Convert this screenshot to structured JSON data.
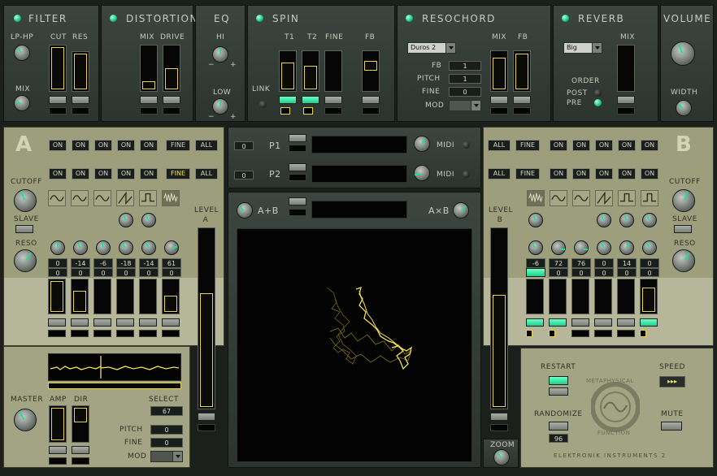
{
  "sections": {
    "filter": "FILTER",
    "distortion": "DISTORTION",
    "eq": "EQ",
    "spin": "SPIN",
    "resochord": "RESOCHORD",
    "reverb": "REVERB",
    "volume": "VOLUME"
  },
  "filter": {
    "lphp": "LP-HP",
    "cut": "CUT",
    "res": "RES",
    "mix": "MIX"
  },
  "distortion": {
    "mix": "MIX",
    "drive": "DRIVE"
  },
  "eq": {
    "hi": "HI",
    "low": "LOW",
    "minus": "−",
    "plus": "+"
  },
  "spin": {
    "link": "LINK",
    "t1": "T1",
    "t2": "T2",
    "fine": "FINE",
    "fb": "FB"
  },
  "resochord": {
    "preset": "Duros 2",
    "mix": "MIX",
    "fb": "FB",
    "fb_label": "FB",
    "fb_value": "1",
    "pitch_label": "PITCH",
    "pitch_value": "1",
    "fine_label": "FINE",
    "fine_value": "0",
    "mod_label": "MOD"
  },
  "reverb": {
    "preset": "Big",
    "mix": "MIX",
    "order": "ORDER",
    "post": "POST",
    "pre": "PRE"
  },
  "volume": {
    "width": "WIDTH"
  },
  "osc_a": {
    "letter": "A",
    "cutoff": "CUTOFF",
    "slave": "SLAVE",
    "reso": "RESO",
    "level": "LEVEL A",
    "row1": [
      "ON",
      "ON",
      "ON",
      "ON",
      "ON",
      "FINE",
      "ALL"
    ],
    "row2": [
      "ON",
      "ON",
      "ON",
      "ON",
      "ON",
      "FINE",
      "ALL"
    ],
    "values": [
      "0",
      "-14",
      "-6",
      "-18",
      "-14",
      "61"
    ],
    "values2": [
      "0",
      "0",
      "0",
      "0",
      "0",
      "0"
    ]
  },
  "osc_b": {
    "letter": "B",
    "cutoff": "CUTOFF",
    "slave": "SLAVE",
    "reso": "RESO",
    "level": "LEVEL B",
    "row1": [
      "ALL",
      "FINE",
      "ON",
      "ON",
      "ON",
      "ON",
      "ON"
    ],
    "row2": [
      "ALL",
      "FINE",
      "ON",
      "ON",
      "ON",
      "ON",
      "ON"
    ],
    "values": [
      "-6",
      "72",
      "76",
      "0",
      "14",
      "0"
    ],
    "values2": [
      "0",
      "0",
      "0",
      "0",
      "0",
      "0"
    ]
  },
  "center": {
    "p1": "P1",
    "p2": "P2",
    "midi": "MIDI",
    "p1_num": "0",
    "p2_num": "0",
    "a_plus_b": "A+B",
    "a_times_b": "A×B",
    "zoom": "ZOOM"
  },
  "master": {
    "master": "MASTER",
    "amp": "AMP",
    "dir": "DIR",
    "select": "SELECT",
    "select_value": "67",
    "pitch": "PITCH",
    "pitch_value": "0",
    "fine": "FINE",
    "fine_value": "0",
    "mod": "MOD"
  },
  "random": {
    "restart": "RESTART",
    "speed": "SPEED",
    "randomize": "RANDOMIZE",
    "random_value": "96",
    "mute": "MUTE",
    "logo_top": "METAPHYSICAL",
    "logo_bottom": "FUNCTION",
    "brand": "ELEKTRONIK INSTRUMENTS 2"
  },
  "colors": {
    "accent": "#1dcf8e",
    "trace": "#f3e34d",
    "panel_dark": "#343c37",
    "panel_tan": "#9d9e7c"
  }
}
